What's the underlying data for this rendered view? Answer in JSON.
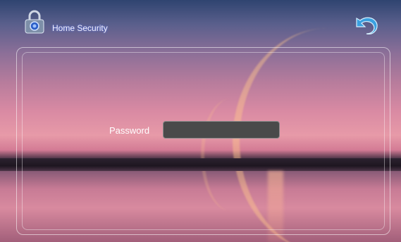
{
  "header": {
    "title": "Home Security",
    "app_icon": "padlock-icon",
    "back_icon": "back-arrow-icon"
  },
  "login": {
    "password_label": "Password",
    "password_value": ""
  },
  "colors": {
    "title_glow": "#5a78ff",
    "input_bg": "#4a4a4a",
    "back_icon": "#3aa0e0"
  }
}
